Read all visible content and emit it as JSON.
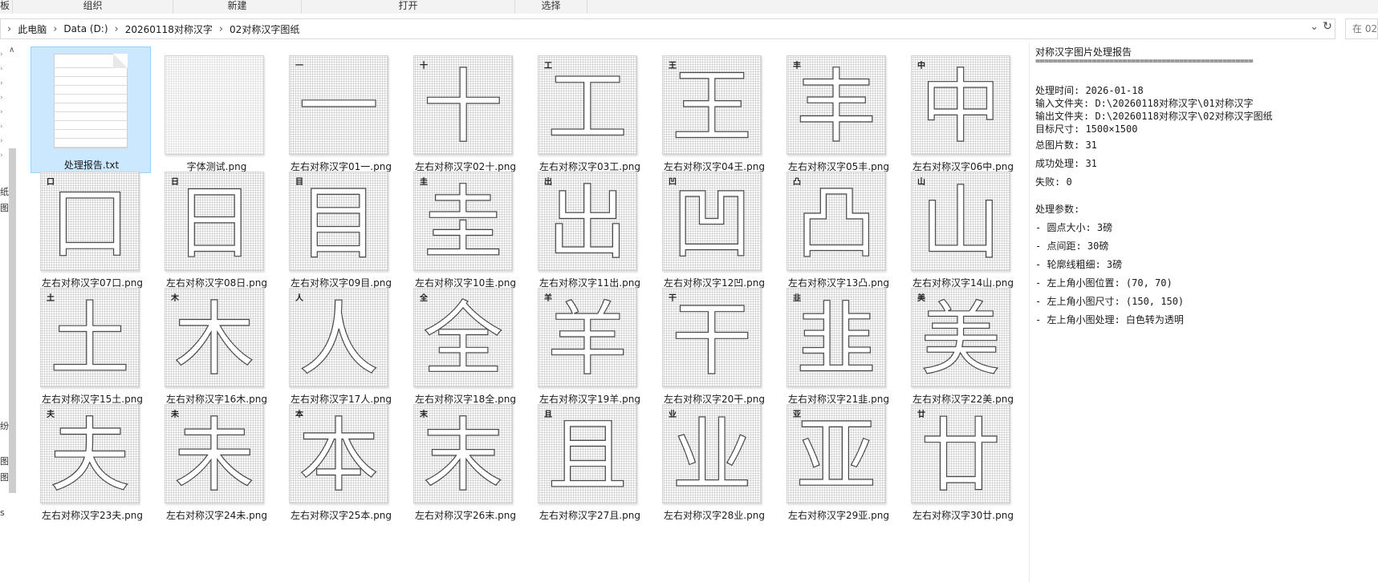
{
  "ribbon": {
    "groups": [
      "板",
      "组织",
      "新建",
      "打开",
      "选择"
    ]
  },
  "address": {
    "crumbs": [
      "此电脑",
      "Data (D:)",
      "20260118对称汉字",
      "02对称汉字图纸"
    ],
    "search_placeholder": "在 02"
  },
  "nav": {
    "glyphs": [
      "纸",
      "图",
      "纷",
      "图",
      "图",
      "s"
    ]
  },
  "files": [
    {
      "name": "处理报告.txt",
      "kind": "text",
      "selected": true
    },
    {
      "name": "字体测试.png",
      "kind": "blank"
    },
    {
      "name": "左右对称汉字01一.png",
      "char": "一"
    },
    {
      "name": "左右对称汉字02十.png",
      "char": "十"
    },
    {
      "name": "左右对称汉字03工.png",
      "char": "工"
    },
    {
      "name": "左右对称汉字04王.png",
      "char": "王"
    },
    {
      "name": "左右对称汉字05丰.png",
      "char": "丰"
    },
    {
      "name": "左右对称汉字06中.png",
      "char": "中"
    },
    {
      "name": "左右对称汉字07口.png",
      "char": "口"
    },
    {
      "name": "左右对称汉字08日.png",
      "char": "日"
    },
    {
      "name": "左右对称汉字09目.png",
      "char": "目"
    },
    {
      "name": "左右对称汉字10圭.png",
      "char": "圭"
    },
    {
      "name": "左右对称汉字11出.png",
      "char": "出"
    },
    {
      "name": "左右对称汉字12凹.png",
      "char": "凹"
    },
    {
      "name": "左右对称汉字13凸.png",
      "char": "凸"
    },
    {
      "name": "左右对称汉字14山.png",
      "char": "山"
    },
    {
      "name": "左右对称汉字15土.png",
      "char": "土"
    },
    {
      "name": "左右对称汉字16木.png",
      "char": "木"
    },
    {
      "name": "左右对称汉字17人.png",
      "char": "人"
    },
    {
      "name": "左右对称汉字18全.png",
      "char": "全"
    },
    {
      "name": "左右对称汉字19羊.png",
      "char": "羊"
    },
    {
      "name": "左右对称汉字20干.png",
      "char": "干"
    },
    {
      "name": "左右对称汉字21韭.png",
      "char": "韭"
    },
    {
      "name": "左右对称汉字22美.png",
      "char": "美"
    },
    {
      "name": "左右对称汉字23夫.png",
      "char": "夫"
    },
    {
      "name": "左右对称汉字24未.png",
      "char": "未"
    },
    {
      "name": "左右对称汉字25本.png",
      "char": "本"
    },
    {
      "name": "左右对称汉字26末.png",
      "char": "末"
    },
    {
      "name": "左右对称汉字27且.png",
      "char": "且"
    },
    {
      "name": "左右对称汉字28业.png",
      "char": "业"
    },
    {
      "name": "左右对称汉字29亚.png",
      "char": "亚"
    },
    {
      "name": "左右对称汉字30廿.png",
      "char": "廿"
    }
  ],
  "preview": {
    "title": "对称汉字图片处理报告",
    "rule": "==================================================",
    "process_time": "处理时间: 2026-01-18",
    "input_folder": "输入文件夹: D:\\20260118对称汉字\\01对称汉字",
    "output_folder": "输出文件夹: D:\\20260118对称汉字\\02对称汉字图纸",
    "target_size": "目标尺寸: 1500×1500",
    "total": "总图片数: 31",
    "success": "成功处理: 31",
    "failed": "失败: 0",
    "params_title": "处理参数:",
    "params": [
      "- 圆点大小: 3磅",
      "- 点间距: 30磅",
      "- 轮廓线粗细: 3磅",
      "- 左上角小图位置: (70, 70)",
      "- 左上角小图尺寸: (150, 150)",
      "- 左上角小图处理: 白色转为透明"
    ]
  }
}
